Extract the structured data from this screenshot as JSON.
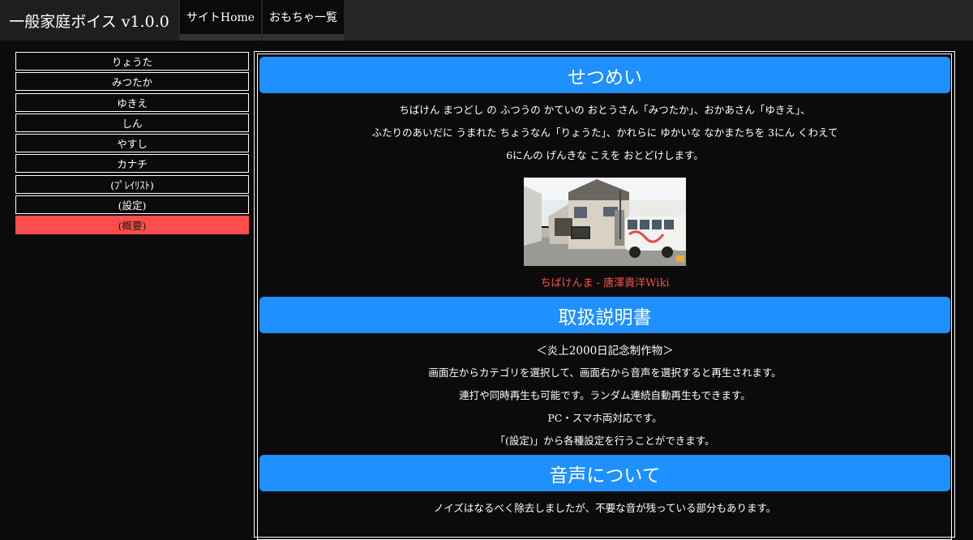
{
  "header": {
    "app_title": "一般家庭ボイス v1.0.0",
    "nav": [
      {
        "label": "サイトHome"
      },
      {
        "label": "おもちゃ一覧"
      }
    ]
  },
  "sidebar": {
    "items": [
      {
        "label": "りょうた",
        "active": false
      },
      {
        "label": "みつたか",
        "active": false
      },
      {
        "label": "ゆきえ",
        "active": false
      },
      {
        "label": "しん",
        "active": false
      },
      {
        "label": "やすし",
        "active": false
      },
      {
        "label": "カナチ",
        "active": false
      },
      {
        "label": "(ﾌﾟﾚｲﾘｽﾄ)",
        "active": false
      },
      {
        "label": "(設定)",
        "active": false
      },
      {
        "label": "(概要)",
        "active": true
      }
    ],
    "active_color": "#ff4d4d"
  },
  "main": {
    "accent_color": "#1e90ff",
    "section1": {
      "title": "せつめい",
      "lines": [
        "ちばけん まつどし の ふつうの かていの おとうさん「みつたか」、おかあさん「ゆきえ」、",
        "ふたりのあいだに うまれた ちょうなん「りょうた」、かれらに ゆかいな なかまたちを 3にん くわえて",
        "6にんの げんきな こえを おとどけします。"
      ],
      "image_alt": "street-view photo of a house with a white minibus",
      "caption": "ちばけんま - 唐澤貴洋Wiki"
    },
    "section2": {
      "title": "取扱説明書",
      "lines": [
        "＜炎上2000日記念制作物＞",
        "画面左からカテゴリを選択して、画面右から音声を選択すると再生されます。",
        "連打や同時再生も可能です。ランダム連続自動再生もできます。",
        "PC・スマホ両対応です。",
        "「(設定)」から各種設定を行うことができます。"
      ]
    },
    "section3": {
      "title": "音声について",
      "lines": [
        "ノイズはなるべく除去しましたが、不要な音が残っている部分もあります。"
      ]
    }
  }
}
